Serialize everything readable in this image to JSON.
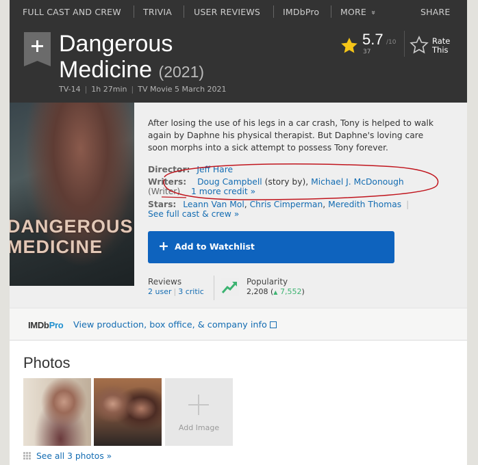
{
  "nav": {
    "full_cast": "FULL CAST AND CREW",
    "trivia": "TRIVIA",
    "user_reviews": "USER REVIEWS",
    "imdbpro": "IMDbPro",
    "more": "MORE",
    "more_chevron": "»",
    "share": "SHARE"
  },
  "title": {
    "name": "Dangerous Medicine",
    "year": "(2021)",
    "certificate": "TV-14",
    "runtime": "1h 27min",
    "release": "TV Movie 5 March 2021"
  },
  "rating": {
    "value": "5.7",
    "max": "/10",
    "count": "37",
    "rate_label": "Rate This",
    "star_color": "#f5c518"
  },
  "poster": {
    "text": "DANGEROUS\nMEDICINE"
  },
  "plot": "After losing the use of his legs in a car crash, Tony is helped to walk again by Daphne his physical therapist. But Daphne's loving care soon morphs into a sick attempt to possess Tony forever.",
  "credits": {
    "director_label": "Director:",
    "director": "Jeff Hare",
    "writers_label": "Writers:",
    "writer1": "Doug Campbell",
    "writer1_role": "(story by),",
    "writer2": "Michael J. McDonough",
    "writer2_role": "(Writer)",
    "more_credit": "1 more credit »",
    "stars_label": "Stars:",
    "star1": "Leann Van Mol",
    "star2": "Chris Cimperman",
    "star3": "Meredith Thomas",
    "pipe": "|",
    "see_full_cast": "See full cast & crew »"
  },
  "watchlist": {
    "plus": "+",
    "label": "Add to Watchlist",
    "color": "#0e63be"
  },
  "reviews": {
    "label": "Reviews",
    "user": "2 user",
    "critic": "3 critic",
    "pipe": "|"
  },
  "popularity": {
    "label": "Popularity",
    "value": "2,208",
    "change_prefix": "(",
    "change_arrow": "▲",
    "change": "7,552",
    "change_suffix": ")"
  },
  "imdbpro": {
    "logo_imdb": "IMDb",
    "logo_pro": "Pro",
    "link": "View production, box office, & company info"
  },
  "photos": {
    "title": "Photos",
    "add_image": "Add Image",
    "see_all": "See all 3 photos »"
  },
  "annotation_color": "#c0141c"
}
